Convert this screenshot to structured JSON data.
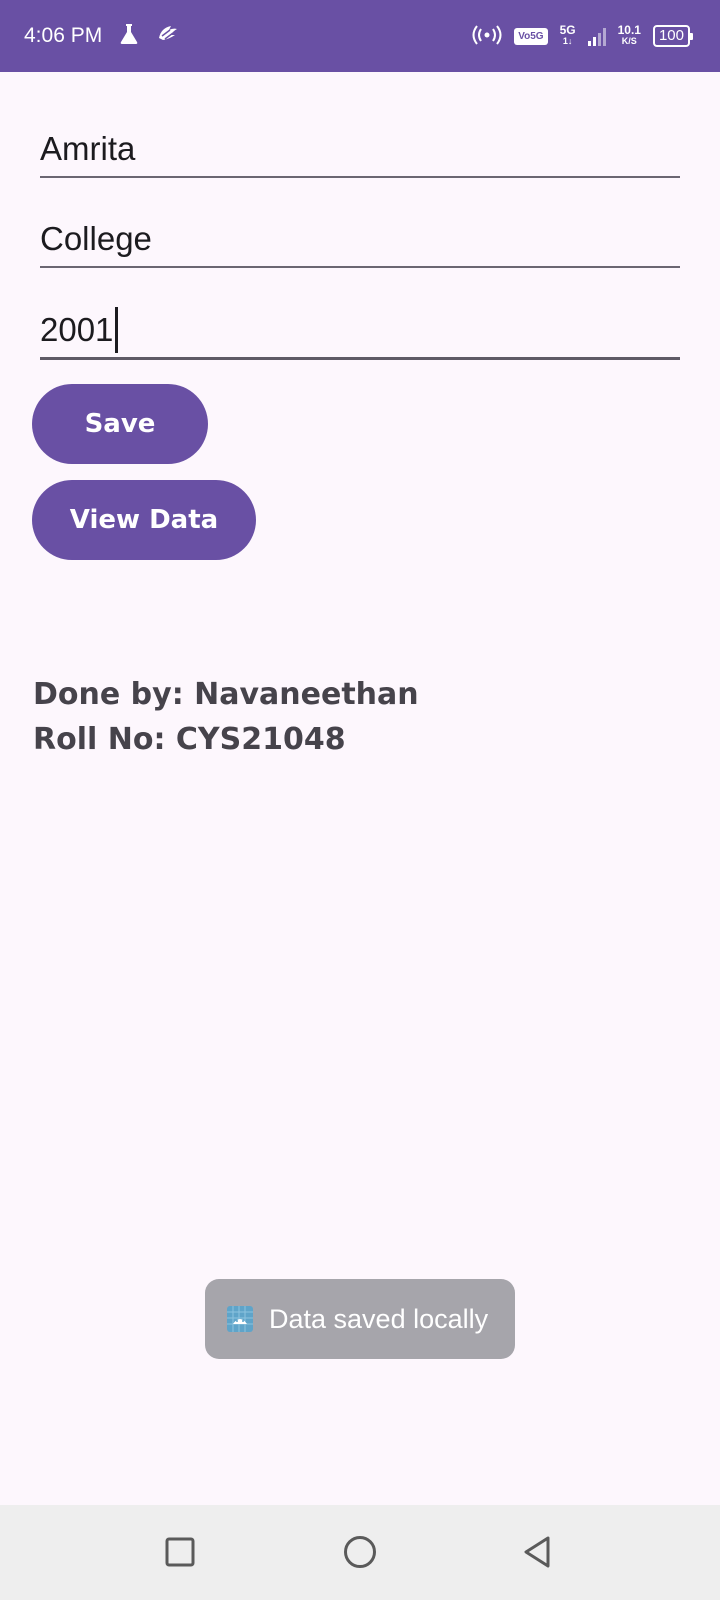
{
  "status_bar": {
    "time": "4:06 PM",
    "network_badge": "Vo5G",
    "network_type": "5G",
    "network_sub": "1↓",
    "speed_value": "10.1",
    "speed_unit": "K/S",
    "battery": "100",
    "icons": [
      "flask-icon",
      "app-notification-icon",
      "hotspot-icon",
      "signal-icon",
      "battery-icon"
    ]
  },
  "form": {
    "name_value": "Amrita",
    "college_value": "College",
    "year_value": "2001"
  },
  "buttons": {
    "save_label": "Save",
    "view_label": "View Data"
  },
  "credits": {
    "done_by": "Done by: Navaneethan",
    "roll_no": "Roll No: CYS21048"
  },
  "toast": {
    "message": "Data saved locally"
  },
  "nav": {
    "icons": [
      "recents-square-icon",
      "home-circle-icon",
      "back-triangle-icon"
    ]
  },
  "colors": {
    "primary": "#6950a4",
    "background": "#fdf7fd",
    "toast_bg": "#a6a5ab",
    "nav_bg": "#eeeeee"
  }
}
